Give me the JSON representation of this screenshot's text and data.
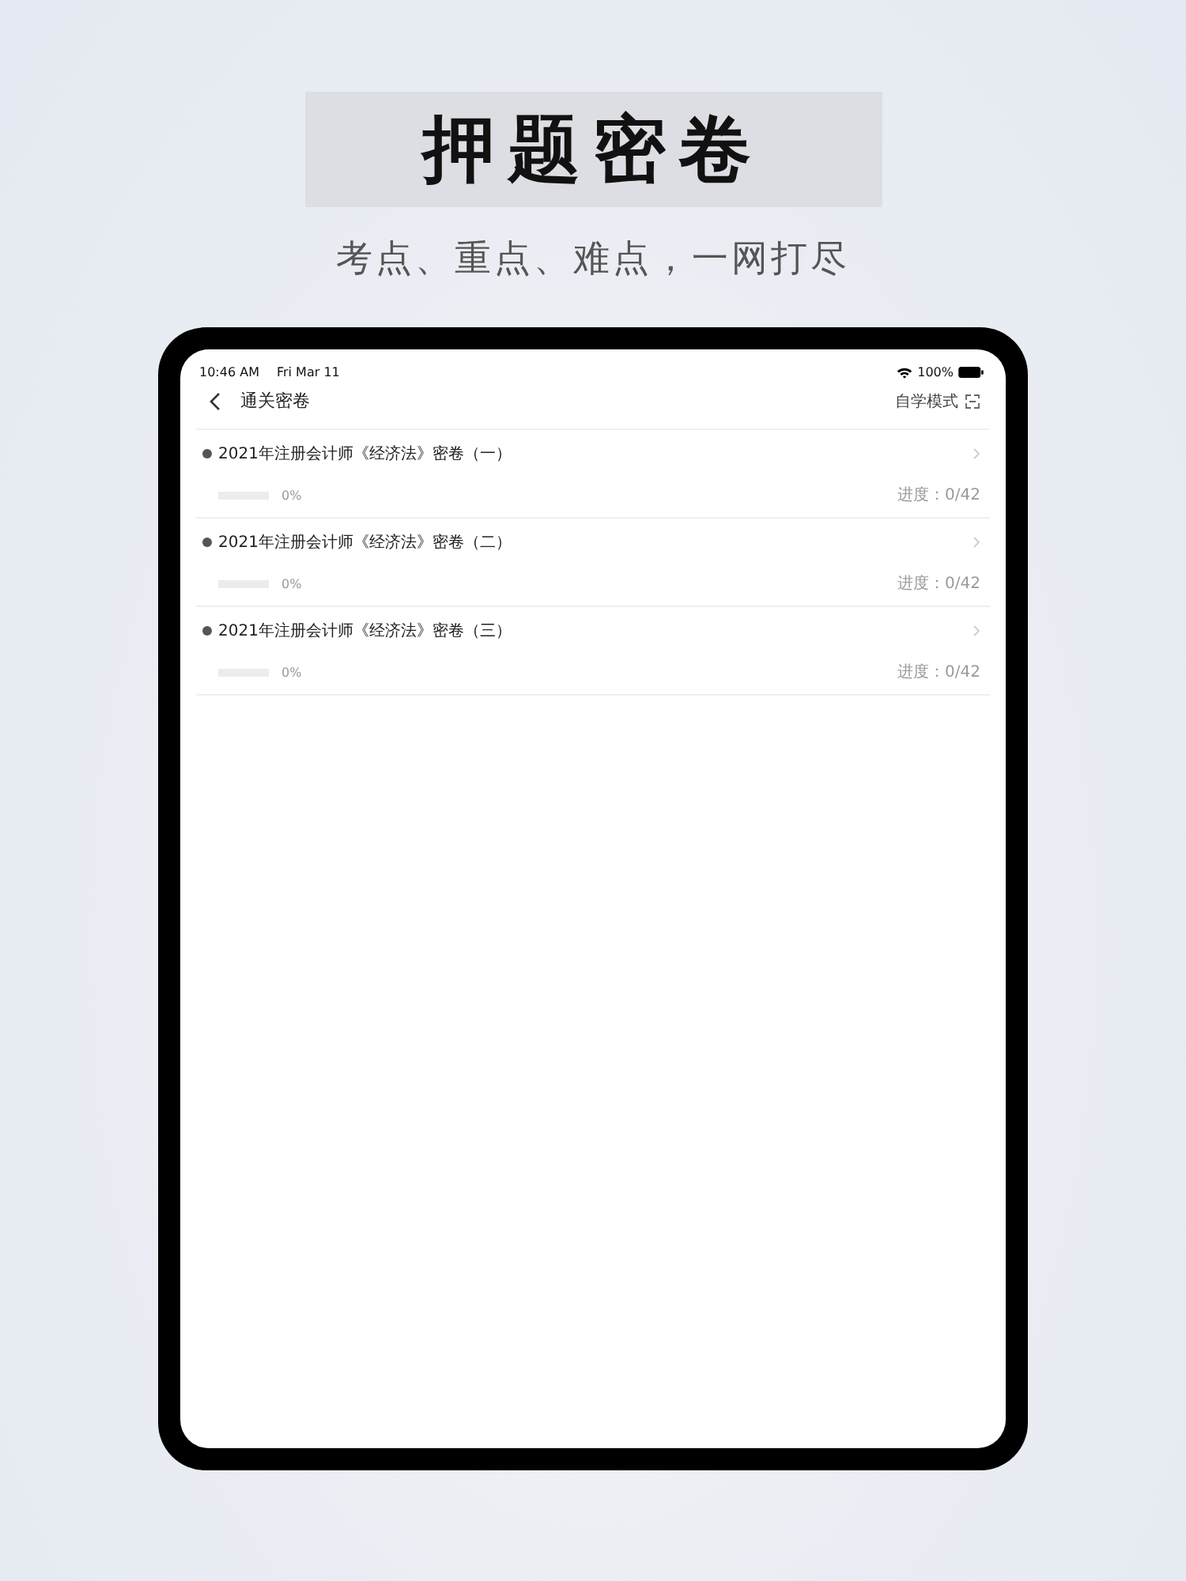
{
  "headline": "押题密卷",
  "subtitle": "考点、重点、难点，一网打尽",
  "status_bar": {
    "time": "10:46 AM",
    "date": "Fri Mar 11",
    "battery": "100%"
  },
  "nav": {
    "title": "通关密卷",
    "mode": "自学模式"
  },
  "papers": [
    {
      "title": "2021年注册会计师《经济法》密卷（一）",
      "level": 0,
      "percent": "0%",
      "progress": "进度：0/42"
    },
    {
      "title": "2021年注册会计师《经济法》密卷（二）",
      "level": 0,
      "percent": "0%",
      "progress": "进度：0/42"
    },
    {
      "title": "2021年注册会计师《经济法》密卷（三）",
      "level": 0,
      "percent": "0%",
      "progress": "进度：0/42"
    }
  ]
}
